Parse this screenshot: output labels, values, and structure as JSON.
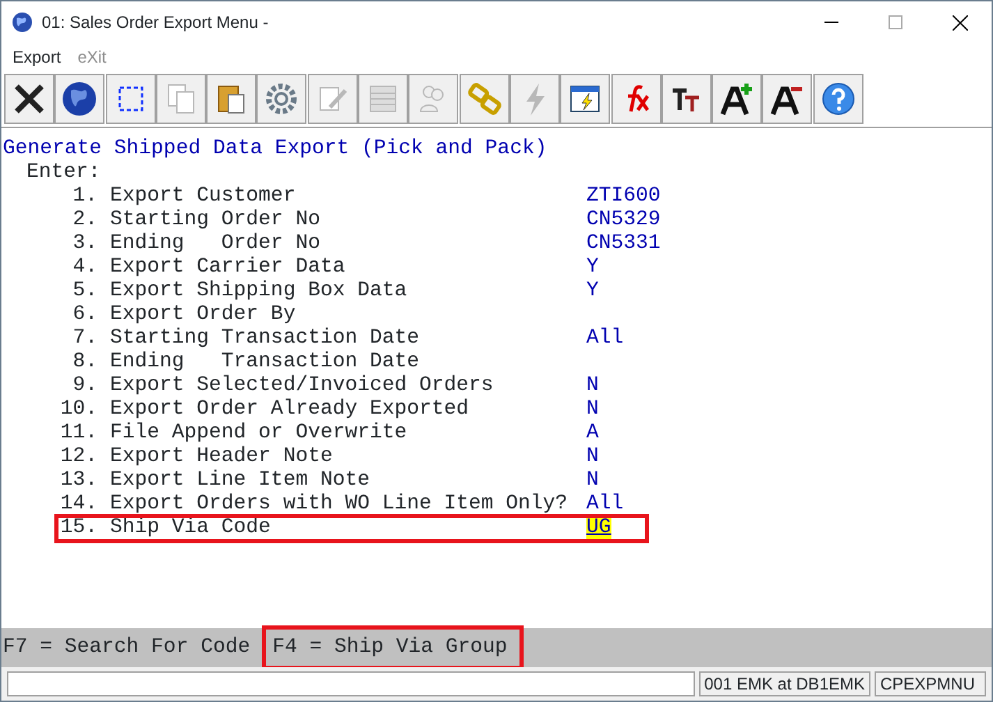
{
  "window": {
    "title": "01: Sales Order Export Menu -"
  },
  "menu": [
    {
      "label": "Export",
      "disabled": false
    },
    {
      "label": "eXit",
      "disabled": true
    }
  ],
  "toolbar": [
    {
      "kind": "close",
      "disabled": false
    },
    {
      "kind": "globe",
      "disabled": false
    },
    {
      "kind": "select",
      "disabled": false
    },
    {
      "kind": "copy",
      "disabled": true
    },
    {
      "kind": "paste",
      "disabled": false
    },
    {
      "kind": "gear",
      "disabled": false
    },
    {
      "kind": "edit",
      "disabled": true
    },
    {
      "kind": "list",
      "disabled": true
    },
    {
      "kind": "users",
      "disabled": true
    },
    {
      "kind": "link",
      "disabled": false
    },
    {
      "kind": "bolt",
      "disabled": true
    },
    {
      "kind": "runwindow",
      "disabled": false
    },
    {
      "kind": "function",
      "disabled": false
    },
    {
      "kind": "font",
      "disabled": false
    },
    {
      "kind": "fontup",
      "disabled": false
    },
    {
      "kind": "fontdown",
      "disabled": false
    },
    {
      "kind": "help",
      "disabled": false
    }
  ],
  "screen": {
    "heading": "Generate Shipped Data Export (Pick and Pack)",
    "prompt": "Enter:",
    "fields": [
      {
        "number": "1.",
        "label": "Export Customer",
        "value": "ZTI600",
        "selected": false
      },
      {
        "number": "2.",
        "label": "Starting Order No",
        "value": "CN5329",
        "selected": false
      },
      {
        "number": "3.",
        "label": "Ending   Order No",
        "value": "CN5331",
        "selected": false
      },
      {
        "number": "4.",
        "label": "Export Carrier Data",
        "value": "Y",
        "selected": false
      },
      {
        "number": "5.",
        "label": "Export Shipping Box Data",
        "value": "Y",
        "selected": false
      },
      {
        "number": "6.",
        "label": "Export Order By",
        "selected": false
      },
      {
        "number": "7.",
        "label": "Starting Transaction Date",
        "value": "All",
        "selected": false
      },
      {
        "number": "8.",
        "label": "Ending   Transaction Date",
        "selected": false
      },
      {
        "number": "9.",
        "label": "Export Selected/Invoiced Orders",
        "value": "N",
        "selected": false
      },
      {
        "number": "10.",
        "label": "Export Order Already Exported",
        "value": "N",
        "selected": false
      },
      {
        "number": "11.",
        "label": "File Append or Overwrite",
        "value": "A",
        "selected": false
      },
      {
        "number": "12.",
        "label": "Export Header Note",
        "value": "N",
        "selected": false
      },
      {
        "number": "13.",
        "label": "Export Line Item Note",
        "value": "N",
        "selected": false
      },
      {
        "number": "14.",
        "label": "Export Orders with WO Line Item Only?",
        "value": "All",
        "selected": false
      },
      {
        "number": "15.",
        "label": "Ship Via Code",
        "value": "UG",
        "selected": true
      }
    ]
  },
  "function_keys": [
    {
      "label": "F7 = Search For Code",
      "highlighted": false
    },
    {
      "label": "F4 = Ship Via Group",
      "highlighted": true
    }
  ],
  "status_bar": {
    "session": "001 EMK at DB1EMK",
    "program": "CPEXPMNU"
  }
}
